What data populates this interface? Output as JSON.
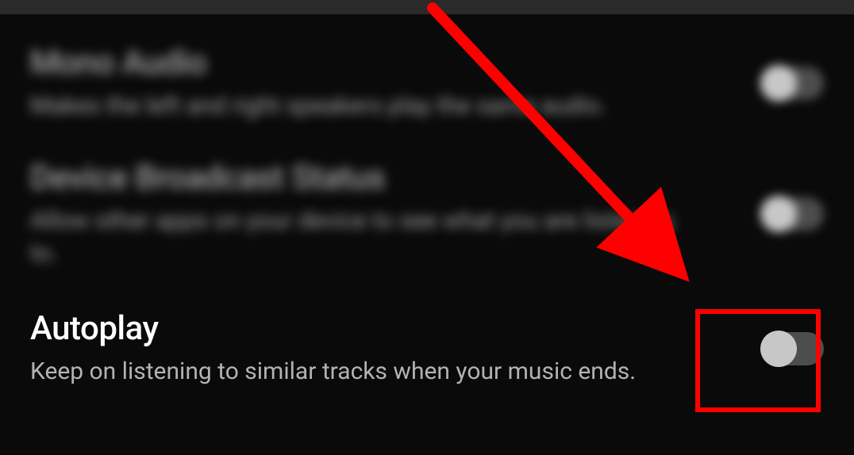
{
  "settings": [
    {
      "key": "mono_audio",
      "title": "Mono Audio",
      "description": "Makes the left and right speakers play the same audio.",
      "enabled": false,
      "blurred": true
    },
    {
      "key": "device_broadcast_status",
      "title": "Device Broadcast Status",
      "description": "Allow other apps on your device to see what you are listening to.",
      "enabled": false,
      "blurred": true
    },
    {
      "key": "autoplay",
      "title": "Autoplay",
      "description": "Keep on listening to similar tracks when your music ends.",
      "enabled": false,
      "blurred": false,
      "highlighted": true
    }
  ],
  "annotation": {
    "arrow_color": "#ff0000",
    "highlight_color": "#ff0000",
    "highlight_target": "autoplay-toggle"
  }
}
